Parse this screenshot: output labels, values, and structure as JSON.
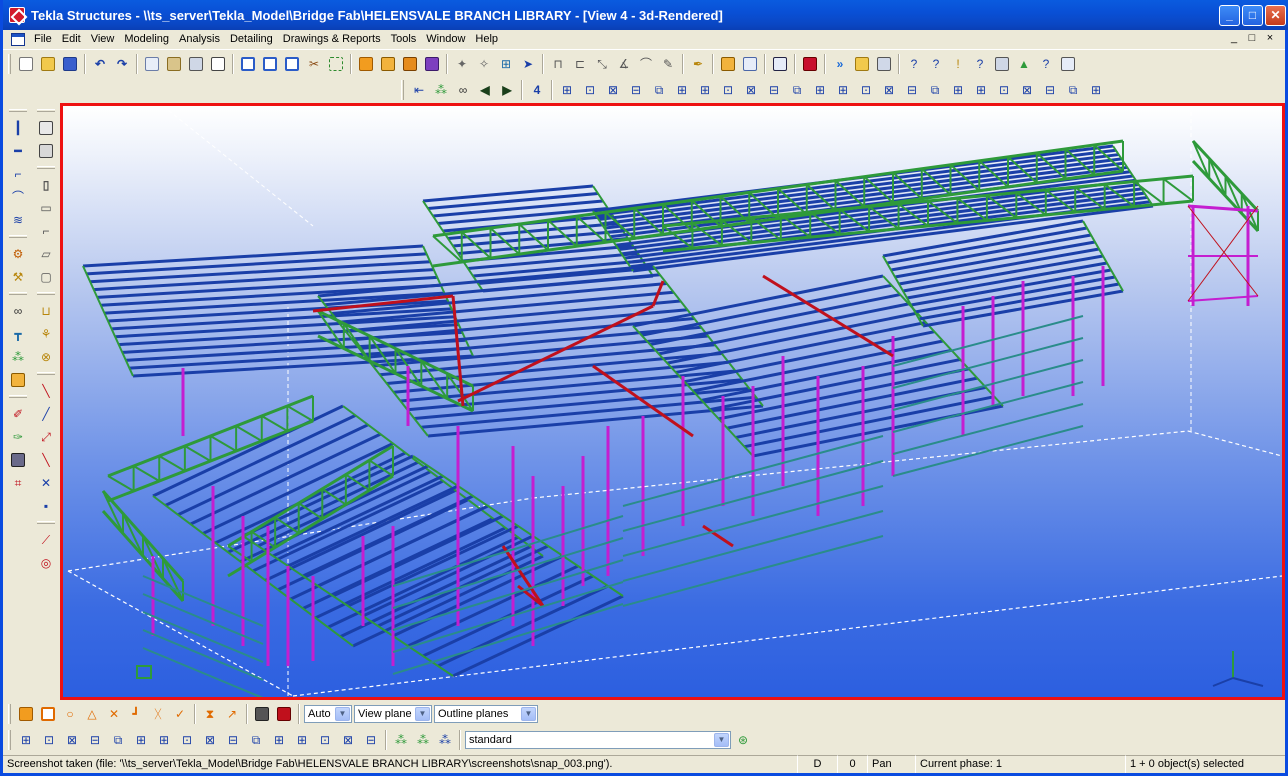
{
  "window": {
    "title": "Tekla Structures - \\\\ts_server\\Tekla_Model\\Bridge Fab\\HELENSVALE BRANCH LIBRARY - [View 4 - 3d-Rendered]",
    "controls": {
      "minimize": "_",
      "maximize": "□",
      "close": "✕"
    }
  },
  "menu": {
    "items": [
      "File",
      "Edit",
      "View",
      "Modeling",
      "Analysis",
      "Detailing",
      "Drawings & Reports",
      "Tools",
      "Window",
      "Help"
    ],
    "mdi_controls": [
      "_",
      "□",
      "×"
    ]
  },
  "toolbar_main": {
    "icons": [
      "new-icon",
      "open-icon",
      "save-icon",
      "undo-icon",
      "redo-icon",
      "copy-icon",
      "paste-icon",
      "print-icon",
      "clipboard-icon",
      "view-icon",
      "view-list-icon",
      "view-properties-icon",
      "cut-icon",
      "select-icon",
      "part-icon",
      "bolt-icon",
      "weld-icon",
      "component-icon",
      "snap-icon",
      "snap-midpoint-icon",
      "grid-icon",
      "point-icon",
      "line-icon",
      "arc-icon",
      "measure-icon",
      "cut-line-icon",
      "polygon-cut-icon",
      "pencil-icon",
      "fit-icon",
      "numbering-icon",
      "model-icon",
      "clash-icon",
      "forward-icon",
      "folder-icon",
      "report-icon",
      "query-icon",
      "inquire-icon",
      "macro-icon",
      "phase-icon",
      "tree-icon",
      "lock-icon",
      "settings-icon"
    ]
  },
  "toolbar_snap": {
    "label": "4",
    "icons": [
      "snap-first-icon",
      "snap-all-icon",
      "binoculars-icon",
      "arrow-left-icon",
      "arrow-right-icon"
    ]
  },
  "statusbar": {
    "message": "Screenshot taken (file: '\\\\ts_server\\Tekla_Model\\Bridge Fab\\HELENSVALE BRANCH LIBRARY\\screenshots\\snap_003.png').",
    "mode": "D",
    "value": "0",
    "pan": "Pan",
    "phase": "Current phase: 1",
    "selection": "1 + 0 object(s) selected"
  },
  "bottom_toolbar": {
    "auto_select": "Auto",
    "view_plane": "View plane",
    "outline_planes": "Outline planes",
    "filter": "standard"
  },
  "view": {
    "name": "View 4 - 3d-Rendered",
    "colors": {
      "purlin": "#1a3fa8",
      "truss": "#2e9a3a",
      "column": "#c41ed0",
      "rafter": "#c0101c",
      "wall": "#2a8c8a",
      "border": "#ee1111"
    }
  }
}
